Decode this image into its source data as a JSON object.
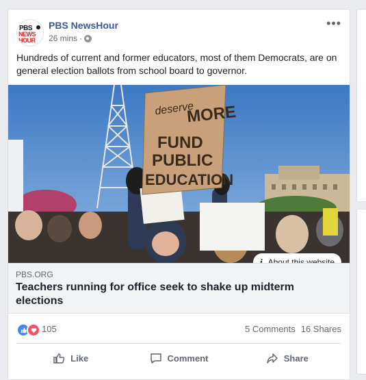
{
  "post": {
    "page_name": "PBS NewsHour",
    "avatar_text": {
      "line1": "PBS",
      "line2": "NEWS",
      "line3": "HOUR"
    },
    "time": "26 mins",
    "separator": "·",
    "more_icon": "•••",
    "text": "Hundreds of current and former educators, most of them Democrats, are on general election ballots from school board to governor.",
    "image": {
      "sign_lines": [
        "deserve",
        "MORE",
        "FUND",
        "PUBLIC",
        "EDUCATION"
      ],
      "about_label": "About this website",
      "about_icon": "i"
    },
    "link": {
      "domain": "PBS.ORG",
      "title": "Teachers running for office seek to shake up midterm elections"
    },
    "reactions": {
      "count": "105",
      "comments": "5 Comments",
      "shares": "16 Shares",
      "colors": {
        "like": "#4a87ec",
        "love": "#f25268"
      }
    },
    "actions": {
      "like": "Like",
      "comment": "Comment",
      "share": "Share"
    }
  }
}
